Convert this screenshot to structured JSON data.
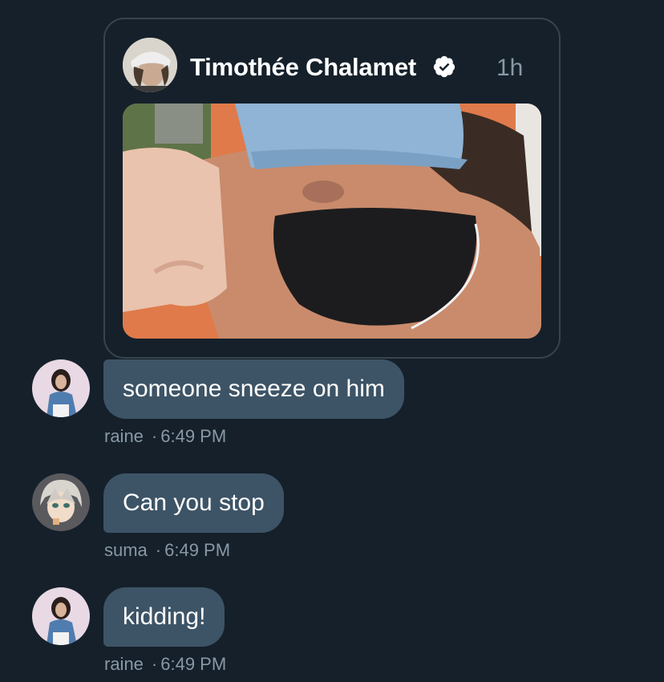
{
  "tweet": {
    "author": "Timothée Chalamet",
    "time": "1h",
    "verified": true
  },
  "messages": [
    {
      "text": "someone sneeze on him",
      "sender": "raine",
      "separator": "·",
      "time": "6:49 PM"
    },
    {
      "text": "Can you stop",
      "sender": "suma",
      "separator": "·",
      "time": "6:49 PM"
    },
    {
      "text": "kidding!",
      "sender": "raine",
      "separator": "·",
      "time": "6:49 PM"
    }
  ],
  "colors": {
    "background": "#15202b",
    "bubble": "#3d5466",
    "border": "#38444d",
    "secondary_text": "#8899a6",
    "verified": "#ffffff"
  }
}
